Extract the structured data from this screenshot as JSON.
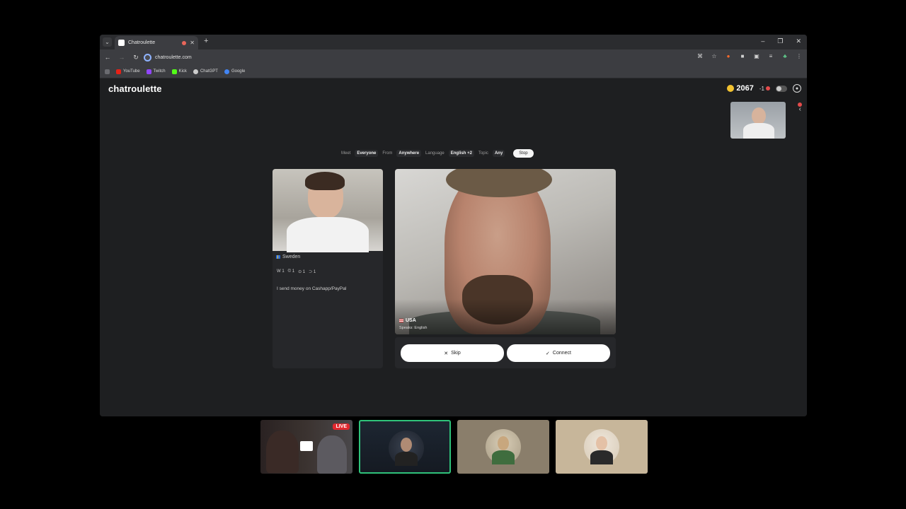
{
  "browser": {
    "tab_title": "Chatroulette",
    "new_tab": "+",
    "url": "chatroulette.com",
    "window_controls": [
      "–",
      "❐",
      "✕"
    ],
    "bookmarks": [
      {
        "label": "YouTube",
        "color": "#e62117"
      },
      {
        "label": "Twitch",
        "color": "#9146ff"
      },
      {
        "label": "Kick",
        "color": "#53fc18"
      },
      {
        "label": "ChatGPT",
        "color": "#cccccc"
      },
      {
        "label": "Google",
        "color": "#4285f4"
      }
    ]
  },
  "app": {
    "logo": "chatroulette",
    "coins": "2067",
    "coin_delta": "-1"
  },
  "filters": {
    "meet_label": "Meet",
    "meet_value": "Everyone",
    "from_label": "From",
    "from_value": "Anywhere",
    "language_label": "Language",
    "language_value": "English +2",
    "topic_label": "Topic",
    "topic_value": "Any",
    "stop_label": "Stop"
  },
  "left_profile": {
    "country": "Sweden",
    "stats": [
      "W 1",
      "© 1",
      "⊙ 1",
      "⊃ 1"
    ],
    "bio": "I send money on Cashapp/PayPal"
  },
  "main_profile": {
    "country": "USA",
    "speaks": "Speaks: English"
  },
  "actions": {
    "skip_icon": "✕",
    "skip_label": "Skip",
    "connect_icon": "✓",
    "connect_label": "Connect"
  },
  "stream": {
    "live_badge": "LIVE"
  }
}
